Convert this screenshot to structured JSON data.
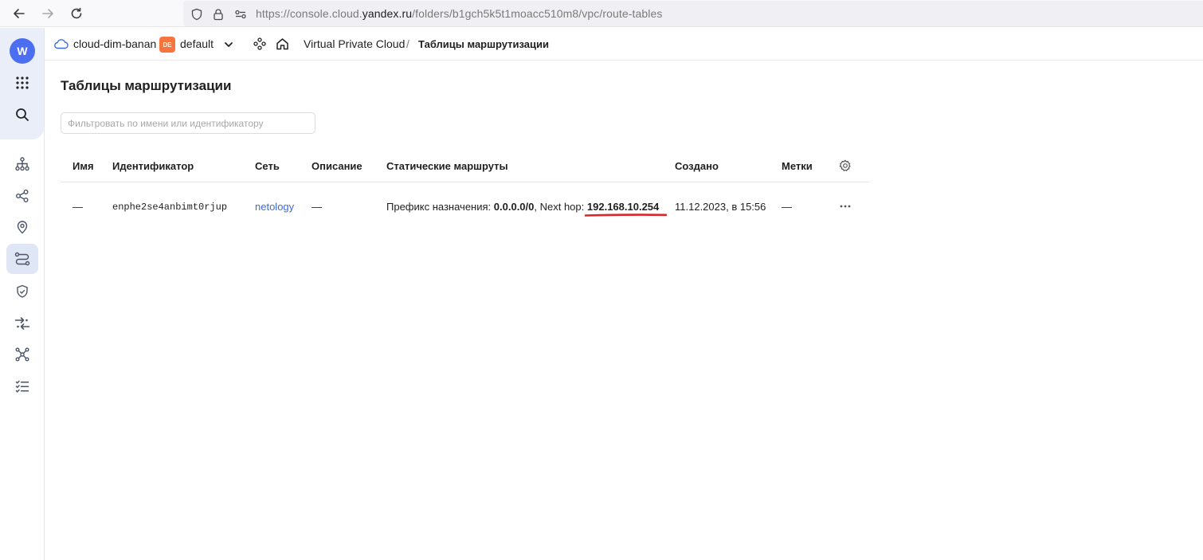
{
  "browser": {
    "url_prefix": "https://console.cloud.",
    "url_domain": "yandex.ru",
    "url_path": "/folders/b1gch5k5t1moacc510m8/vpc/route-tables"
  },
  "sidebar": {
    "logo_letter": "W",
    "items": [
      {
        "icon": "apps-grid-icon"
      },
      {
        "icon": "search-icon"
      },
      {
        "icon": "network-tree-icon"
      },
      {
        "icon": "share-nodes-icon"
      },
      {
        "icon": "location-pin-icon"
      },
      {
        "icon": "routes-icon",
        "active": true
      },
      {
        "icon": "shield-icon"
      },
      {
        "icon": "arrows-exchange-icon"
      },
      {
        "icon": "hub-icon"
      },
      {
        "icon": "checklist-icon"
      }
    ]
  },
  "header": {
    "cloud_name": "cloud-dim-banan",
    "folder_badge": "DE",
    "folder_name": "default",
    "service": "Virtual Private Cloud",
    "separator": "/",
    "current_page": "Таблицы маршрутизации"
  },
  "main": {
    "title": "Таблицы маршрутизации",
    "filter_placeholder": "Фильтровать по имени или идентификатору",
    "columns": [
      "Имя",
      "Идентификатор",
      "Сеть",
      "Описание",
      "Статические маршруты",
      "Создано",
      "Метки"
    ],
    "rows": [
      {
        "name": "—",
        "id": "enphe2se4anbimt0rjup",
        "network": "netology",
        "description": "—",
        "route_prefix_label": "Префикс назначения:",
        "route_prefix": "0.0.0.0/0",
        "route_hop_label": ", Next hop:",
        "route_hop": "192.168.10.254",
        "created": "11.12.2023, в 15:56",
        "labels": "—"
      }
    ]
  },
  "colors": {
    "accent": "#4c6ef0",
    "link": "#3b6bd8",
    "badge": "#f7743e",
    "highlight_underline": "#d9262b"
  }
}
